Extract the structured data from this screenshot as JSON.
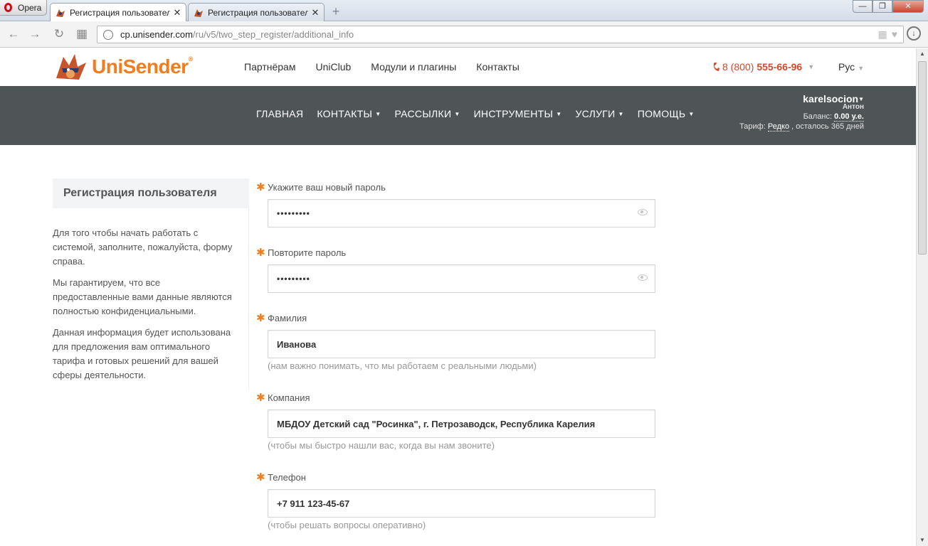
{
  "browser": {
    "opera_label": "Opera",
    "tabs": [
      {
        "label": "Регистрация пользователя",
        "close": "✕"
      },
      {
        "label": "Регистрация пользователя",
        "close": "✕"
      }
    ],
    "new_tab": "+",
    "url_host": "cp.unisender.com",
    "url_path": "/ru/v5/two_step_register/additional_info",
    "window": {
      "minimize": "—",
      "restore": "❐",
      "close": "✕"
    }
  },
  "header": {
    "logo_text_uni": "Uni",
    "logo_text_sender": "Sender",
    "logo_reg": "®",
    "nav": [
      "Партнёрам",
      "UniClub",
      "Модули и плагины",
      "Контакты"
    ],
    "phone_prefix": "8 (800)",
    "phone_number": "555-66-96",
    "language": "Рус"
  },
  "mainnav": {
    "items": [
      {
        "label": "ГЛАВНАЯ",
        "caret": ""
      },
      {
        "label": "КОНТАКТЫ",
        "caret": "▼"
      },
      {
        "label": "РАССЫЛКИ",
        "caret": "▼"
      },
      {
        "label": "ИНСТРУМЕНТЫ",
        "caret": "▼"
      },
      {
        "label": "УСЛУГИ",
        "caret": "▼"
      },
      {
        "label": "ПОМОЩЬ",
        "caret": "▼"
      }
    ],
    "account": {
      "login": "karelsocion",
      "name": "Антон",
      "balance_label": "Баланс:",
      "balance_value": "0.00 у.е.",
      "tariff_label": "Тариф:",
      "tariff_value": "Редко",
      "tariff_rest": ", осталось 365 дней"
    }
  },
  "sidebar": {
    "title": "Регистрация пользователя",
    "paragraphs": [
      "Для того чтобы начать работать с системой, заполните, пожалуйста, форму справа.",
      "Мы гарантируем, что все предоставленные вами данные являются полностью конфиденциальными.",
      "Данная информация будет использована для предложения вам оптимального тарифа и готовых решений для вашей сферы деятельности."
    ]
  },
  "form": {
    "required_mark": "✱",
    "new_password": {
      "label": "Укажите ваш новый пароль",
      "value": "•••••••••"
    },
    "repeat_password": {
      "label": "Повторите пароль",
      "value": "•••••••••"
    },
    "surname": {
      "label": "Фамилия",
      "value": "Иванова",
      "hint": "(нам важно понимать, что мы работаем с реальными людьми)"
    },
    "company": {
      "label": "Компания",
      "value": "МБДОУ Детский сад \"Росинка\", г. Петрозаводск, Республика Карелия",
      "hint": "(чтобы мы быстро нашли вас, когда вы нам звоните)"
    },
    "phone": {
      "label": "Телефон",
      "value": "+7 911 123-45-67",
      "hint": "(чтобы решать вопросы оперативно)"
    }
  },
  "colors": {
    "accent": "#f07d1f",
    "nav_bg": "#4f5557",
    "phone": "#d9472b"
  }
}
